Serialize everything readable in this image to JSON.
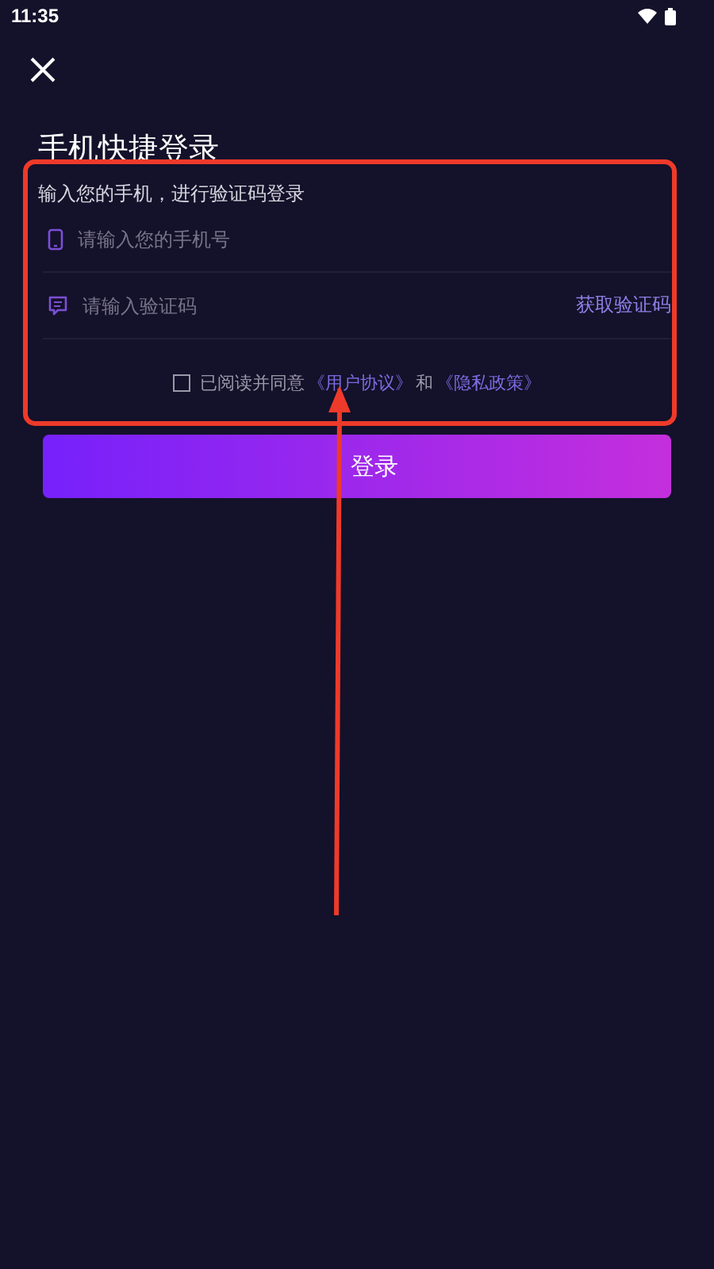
{
  "status_bar": {
    "time": "11:35"
  },
  "title": "手机快捷登录",
  "subtitle": "输入您的手机，进行验证码登录",
  "phone_field": {
    "placeholder": "请输入您的手机号"
  },
  "code_field": {
    "placeholder": "请输入验证码",
    "action": "获取验证码"
  },
  "agreement": {
    "checked": false,
    "text": "已阅读并同意",
    "links": [
      "《用户协议》",
      "《隐私政策》"
    ],
    "joiner": "和"
  },
  "login_button": "登录"
}
